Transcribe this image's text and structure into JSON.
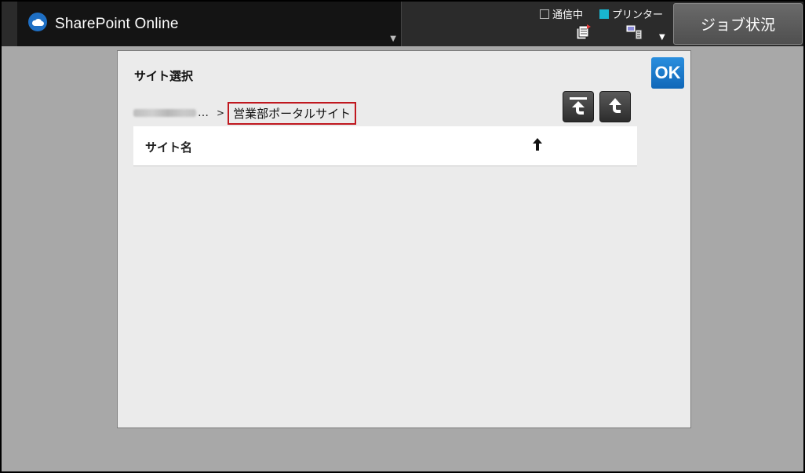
{
  "header": {
    "app_title": "SharePoint Online",
    "app_dropdown_icon": "dropdown-triangle",
    "status_communicating": "通信中",
    "status_printer": "プリンター",
    "printer_status_color": "#19b5cf",
    "job_status_button": "ジョブ状況"
  },
  "dialog": {
    "title": "サイト選択",
    "ok_button": "OK",
    "breadcrumb": {
      "ellipsis": "…",
      "separator": ">",
      "current": "営業部ポータルサイト"
    },
    "nav_buttons": [
      "go-to-top-icon",
      "go-up-icon"
    ],
    "list": {
      "column_header": "サイト名",
      "sort_direction": "ascending",
      "rows": []
    }
  },
  "colors": {
    "ok_blue": "#0f67b8",
    "highlight_red": "#c0181f",
    "dialog_bg": "#ebebeb"
  }
}
